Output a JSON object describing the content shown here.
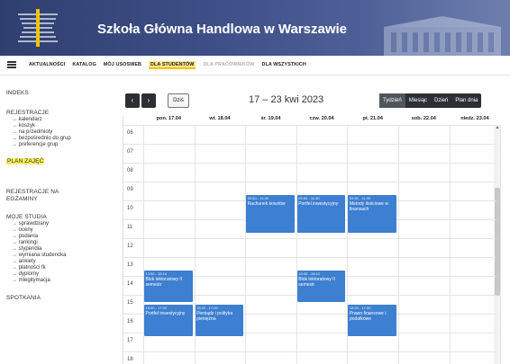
{
  "header": {
    "title": "Szkoła Główna Handlowa w Warszawie"
  },
  "nav": {
    "items": [
      {
        "label": "AKTUALNOŚCI"
      },
      {
        "label": "KATALOG"
      },
      {
        "label": "MÓJ USOSWEB"
      },
      {
        "label": "DLA STUDENTÓW",
        "active": true
      },
      {
        "label": "DLA PRACOWNIKÓW",
        "faded": true
      },
      {
        "label": "DLA WSZYSTKICH"
      }
    ]
  },
  "sidebar": {
    "indeks": "INDEKS",
    "rejestracje": "REJESTRACJE",
    "rej_items": [
      "kalendarz",
      "koszyk",
      "na przedmioty",
      "bezpośrednio do grup",
      "preferencje grup"
    ],
    "plan": "PLAN ZAJĘĆ",
    "rej_egz_1": "REJESTRACJE NA",
    "rej_egz_2": "EGZAMINY",
    "moje": "MOJE STUDIA",
    "moje_items": [
      "sprawdziany",
      "oceny",
      "podania",
      "rankingi",
      "stypendia",
      "wymiana studencka",
      "ankiety",
      "płatności fk",
      "dyplomy",
      "mlegitymacja"
    ],
    "spotkania": "SPOTKANIA"
  },
  "toolbar": {
    "prev": "‹",
    "next": "›",
    "today": "Dziś",
    "week": "17 – 23 kwi 2023",
    "views": [
      {
        "label": "Tydzień",
        "active": true
      },
      {
        "label": "Miesiąc"
      },
      {
        "label": "Dzień"
      },
      {
        "label": "Plan dnia"
      }
    ]
  },
  "calendar": {
    "days": [
      "pon. 17.04",
      "wt. 18.04",
      "śr. 19.04",
      "czw. 20.04",
      "pt. 21.04",
      "sob. 22.04",
      "niedz. 23.04"
    ],
    "hours": [
      "06",
      "07",
      "08",
      "09",
      "10",
      "11",
      "12",
      "13",
      "14",
      "15",
      "16",
      "17",
      "18"
    ],
    "events": [
      {
        "day": 2,
        "start": 9.5,
        "end": 11.5,
        "time": "09:50 - 11:30",
        "title": "Rachunek kosztów"
      },
      {
        "day": 3,
        "start": 9.5,
        "end": 11.5,
        "time": "09:50 - 11:30",
        "title": "Portfel inwestycyjny"
      },
      {
        "day": 4,
        "start": 9.5,
        "end": 11.5,
        "time": "09:50 - 11:30",
        "title": "Metody ilościowe w finansach"
      },
      {
        "day": 0,
        "start": 13.5,
        "end": 15.2,
        "time": "13:30 - 15:10",
        "title": "Blok lektoratowy II semestr"
      },
      {
        "day": 3,
        "start": 13.5,
        "end": 15.2,
        "time": "13:30 - 15:10",
        "title": "Blok lektoratowy II semestr"
      },
      {
        "day": 0,
        "start": 15.33,
        "end": 17.0,
        "time": "15:20 - 17:00",
        "title": "Portfel inwestycyjny"
      },
      {
        "day": 1,
        "start": 15.33,
        "end": 17.0,
        "time": "15:20 - 17:00",
        "title": "Pieniądz i polityka pieniężna"
      },
      {
        "day": 4,
        "start": 15.33,
        "end": 17.0,
        "time": "15:20 - 17:00",
        "title": "Prawo finansowe i podatkowe"
      }
    ]
  },
  "colors": {
    "event": "#3d7fd0",
    "header": "#3d4e86",
    "highlight": "#f6ee60"
  }
}
